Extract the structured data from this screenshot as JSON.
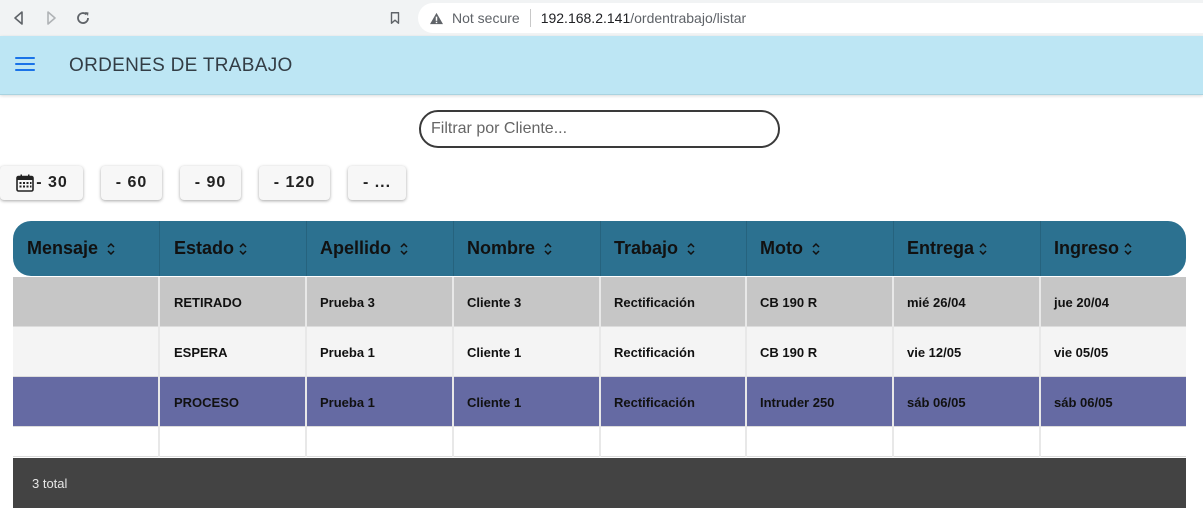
{
  "browser": {
    "security_label": "Not secure",
    "url_host": "192.168.2.141",
    "url_path": "/ordentrabajo/listar"
  },
  "app": {
    "title": "ORDENES DE TRABAJO"
  },
  "search": {
    "placeholder": "Filtrar por Cliente...",
    "value": ""
  },
  "day_filters": [
    "- 30",
    "- 60",
    "- 90",
    "- 120",
    "- ..."
  ],
  "table": {
    "columns": [
      "Mensaje",
      "Estado",
      "Apellido",
      "Nombre",
      "Trabajo",
      "Moto",
      "Entrega",
      "Ingreso"
    ],
    "rows": [
      {
        "mensaje": "",
        "estado": "RETIRADO",
        "apellido": "Prueba 3",
        "nombre": "Cliente 3",
        "trabajo": "Rectificación",
        "moto": "CB 190 R",
        "entrega": "mié 26/04",
        "ingreso": "jue 20/04"
      },
      {
        "mensaje": "",
        "estado": "ESPERA",
        "apellido": "Prueba 1",
        "nombre": "Cliente 1",
        "trabajo": "Rectificación",
        "moto": "CB 190 R",
        "entrega": "vie 12/05",
        "ingreso": "vie 05/05"
      },
      {
        "mensaje": "",
        "estado": "PROCESO",
        "apellido": "Prueba 1",
        "nombre": "Cliente 1",
        "trabajo": "Rectificación",
        "moto": "Intruder 250",
        "entrega": "sáb 06/05",
        "ingreso": "sáb 06/05"
      }
    ],
    "footer_total": "3 total"
  },
  "colors": {
    "app_bar": "#bde6f4",
    "table_header": "#2c7190",
    "row_retirado": "#c6c6c6",
    "row_espera": "#f4f4f4",
    "row_proceso": "#656aa3",
    "footer": "#434343"
  }
}
